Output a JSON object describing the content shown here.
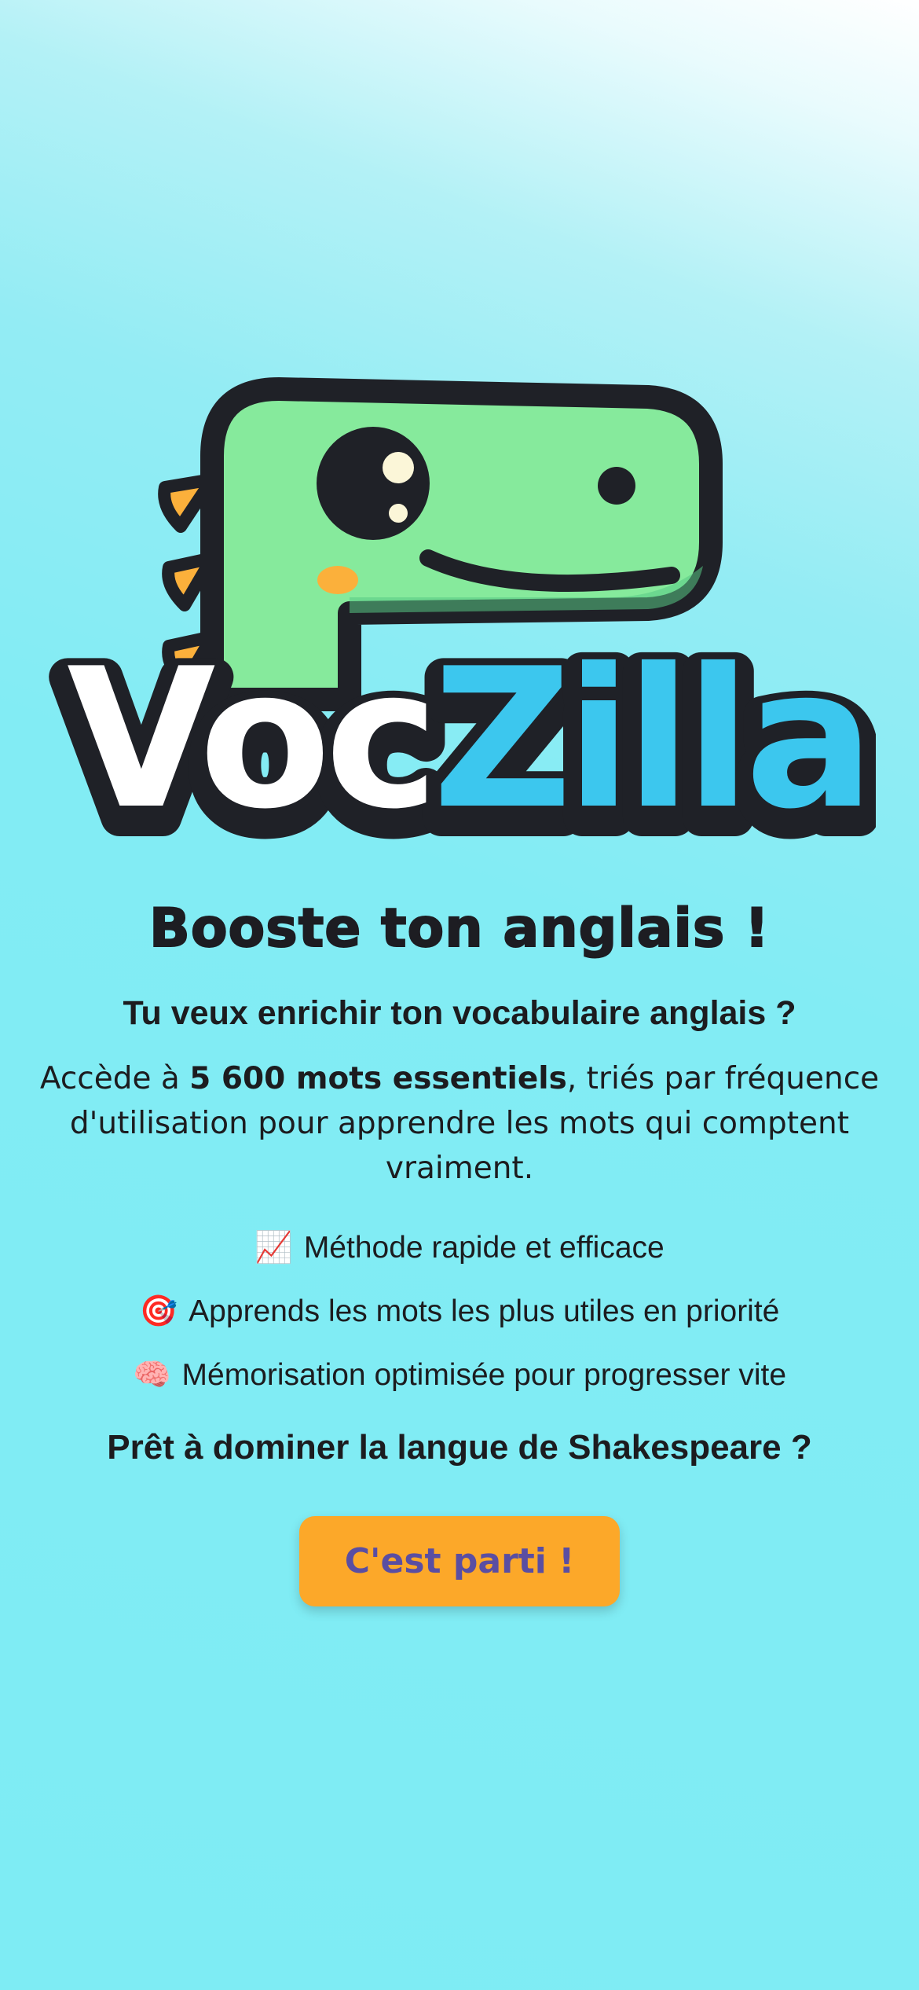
{
  "logo": {
    "text_part1": "Voc",
    "text_part2": "Zilla",
    "colors": {
      "white": "#ffffff",
      "blue": "#3cc7ee",
      "outline": "#1f2127",
      "dino_green": "#86ea9c",
      "spikes": "#fbb03b"
    }
  },
  "headline": "Booste ton anglais !",
  "subheadline": "Tu veux enrichir ton vocabulaire anglais ?",
  "description": {
    "prefix": "Accède à ",
    "highlight": "5 600 mots essentiels",
    "suffix": ", triés par fréquence d'utilisation pour apprendre les mots qui comptent vraiment."
  },
  "features": [
    {
      "icon": "chart-increasing-icon",
      "emoji": "📈",
      "text": "Méthode rapide et efficace"
    },
    {
      "icon": "target-icon",
      "emoji": "🎯",
      "text": "Apprends les mots les plus utiles en priorité"
    },
    {
      "icon": "brain-icon",
      "emoji": "🧠",
      "text": "Mémorisation optimisée pour progresser vite"
    }
  ],
  "cta_question": "Prêt à dominer la langue de Shakespeare ?",
  "cta_button": "C'est parti !",
  "colors": {
    "accent": "#fca829",
    "button_text": "#5a4ea2",
    "background": "#7eecf4"
  }
}
